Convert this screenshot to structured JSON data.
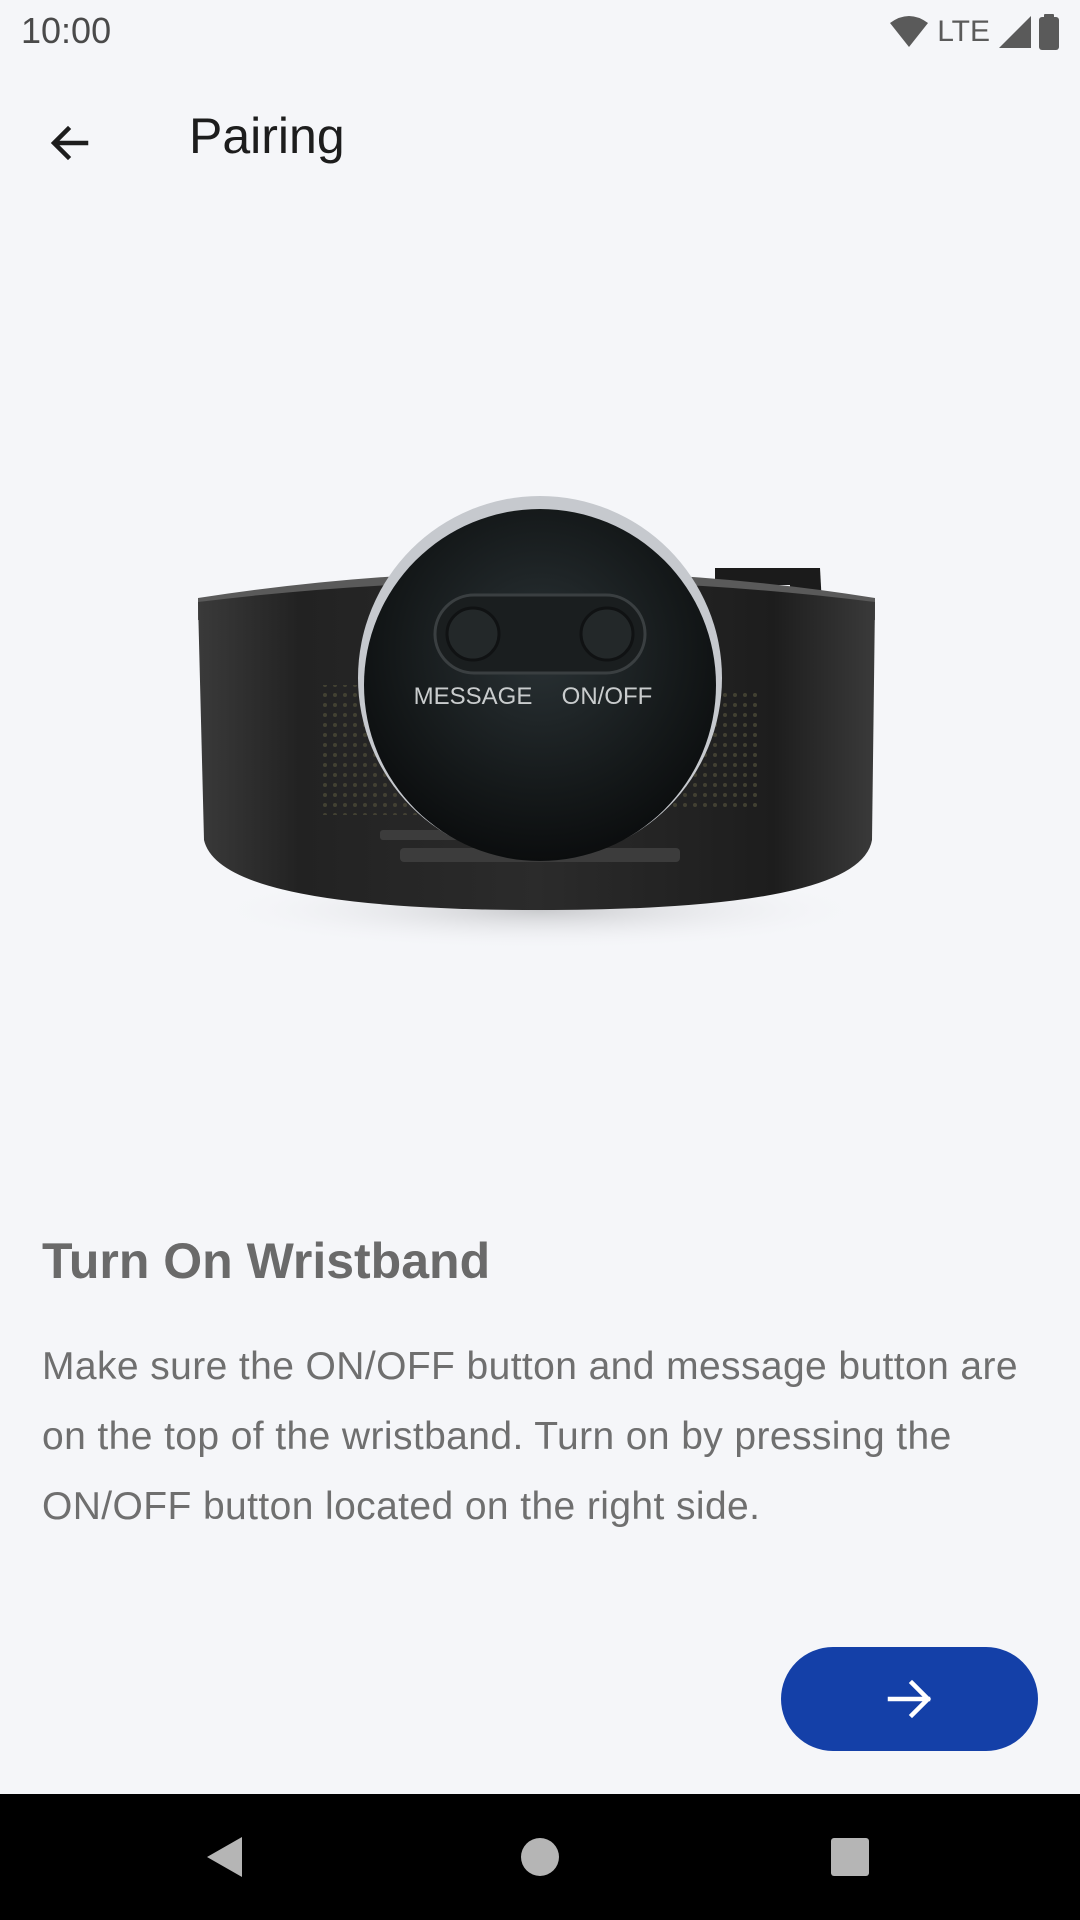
{
  "status_bar": {
    "time": "10:00",
    "network": "LTE",
    "icons": [
      "wifi-icon",
      "cellular-signal-icon",
      "battery-icon"
    ]
  },
  "app_bar": {
    "title": "Pairing",
    "back_icon": "arrow-left-icon"
  },
  "illustration": {
    "device": "wristband",
    "button_labels": {
      "message": "MESSAGE",
      "on_off": "ON/OFF"
    }
  },
  "content": {
    "title": "Turn On Wristband",
    "body": "Make sure the ON/OFF button and message button are on the top of the wristband. Turn on by pressing the ON/OFF button located on the right side."
  },
  "next_button": {
    "icon": "arrow-right-icon",
    "color": "#1440a8"
  },
  "nav_bar": {
    "items": [
      "back-triangle-icon",
      "home-circle-icon",
      "recents-square-icon"
    ]
  }
}
